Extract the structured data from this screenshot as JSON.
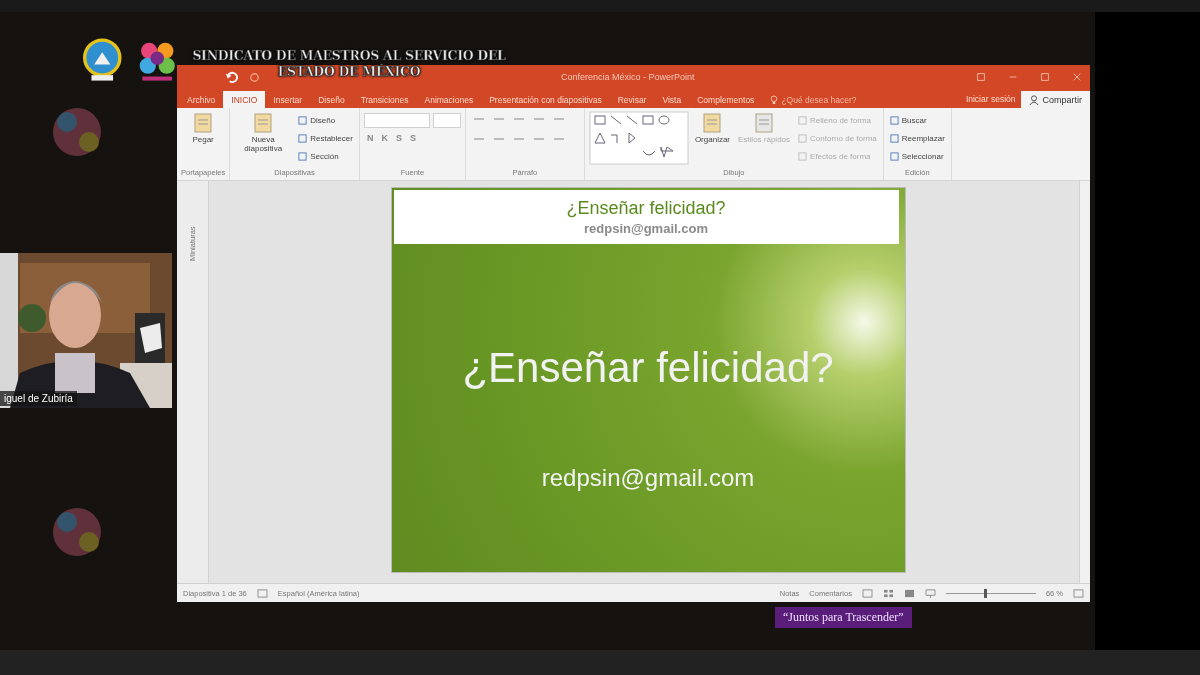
{
  "header": {
    "lines": [
      "SINDICATO DE MAESTROS AL SERVICIO DEL",
      "ESTADO DE MÉXICO"
    ]
  },
  "video": {
    "name": "iguel de Zubiría"
  },
  "window": {
    "title": "Conferencia México - PowerPoint"
  },
  "tabs": [
    {
      "label": "Archivo",
      "selected": false
    },
    {
      "label": "INICIO",
      "selected": true
    },
    {
      "label": "Insertar",
      "selected": false
    },
    {
      "label": "Diseño",
      "selected": false
    },
    {
      "label": "Transiciones",
      "selected": false
    },
    {
      "label": "Animaciones",
      "selected": false
    },
    {
      "label": "Presentación con diapositivas",
      "selected": false
    },
    {
      "label": "Revisar",
      "selected": false
    },
    {
      "label": "Vista",
      "selected": false
    },
    {
      "label": "Complementos",
      "selected": false
    }
  ],
  "tell_me": {
    "placeholder": "¿Qué desea hacer?"
  },
  "account": {
    "sign_in": "Iniciar sesión",
    "share": "Compartir"
  },
  "ribbon": [
    {
      "label": "Portapapeles",
      "items": [
        {
          "label": "Pegar",
          "kind": "large",
          "disabled": false
        }
      ]
    },
    {
      "label": "Diapositivas",
      "items": [
        {
          "label": "Nueva diapositiva",
          "kind": "large",
          "disabled": false
        },
        {
          "label": "Diseño",
          "kind": "small",
          "disabled": false
        },
        {
          "label": "Restablecer",
          "kind": "small",
          "disabled": false
        },
        {
          "label": "Sección",
          "kind": "small",
          "disabled": false
        }
      ]
    },
    {
      "label": "Fuente",
      "items": [
        {
          "kind": "fields"
        },
        {
          "kind": "formats",
          "labels": [
            "N",
            "K",
            "S",
            "S"
          ]
        }
      ]
    },
    {
      "label": "Párrafo",
      "items": [
        {
          "kind": "paragraph"
        }
      ]
    },
    {
      "label": "Dibujo",
      "items": [
        {
          "kind": "shapes"
        },
        {
          "label": "Organizar",
          "kind": "large",
          "disabled": false
        },
        {
          "label": "Estilos rápidos",
          "kind": "large",
          "disabled": true
        },
        {
          "label": "Relleno de forma",
          "kind": "small",
          "disabled": true
        },
        {
          "label": "Contorno de forma",
          "kind": "small",
          "disabled": true
        },
        {
          "label": "Efectos de forma",
          "kind": "small",
          "disabled": true
        }
      ]
    },
    {
      "label": "Edición",
      "items": [
        {
          "label": "Buscar",
          "kind": "small",
          "disabled": false
        },
        {
          "label": "Reemplazar",
          "kind": "small",
          "disabled": false
        },
        {
          "label": "Seleccionar",
          "kind": "small",
          "disabled": false
        }
      ]
    }
  ],
  "thumbnails_pane": {
    "label": "Miniaturas"
  },
  "slide": {
    "header_title": "¿Enseñar felicidad?",
    "header_email": "redpsin@gmail.com",
    "title": "¿Enseñar felicidad?",
    "email": "redpsin@gmail.com"
  },
  "status_bar": {
    "slide_count": "Diapositiva 1 de 36",
    "language": "Español (América latina)",
    "notes": "Notas",
    "comments": "Comentarios",
    "zoom": {
      "level": 0.42
    },
    "zoom_reading": "66 %"
  },
  "banner": "“Juntos para Trascender”"
}
